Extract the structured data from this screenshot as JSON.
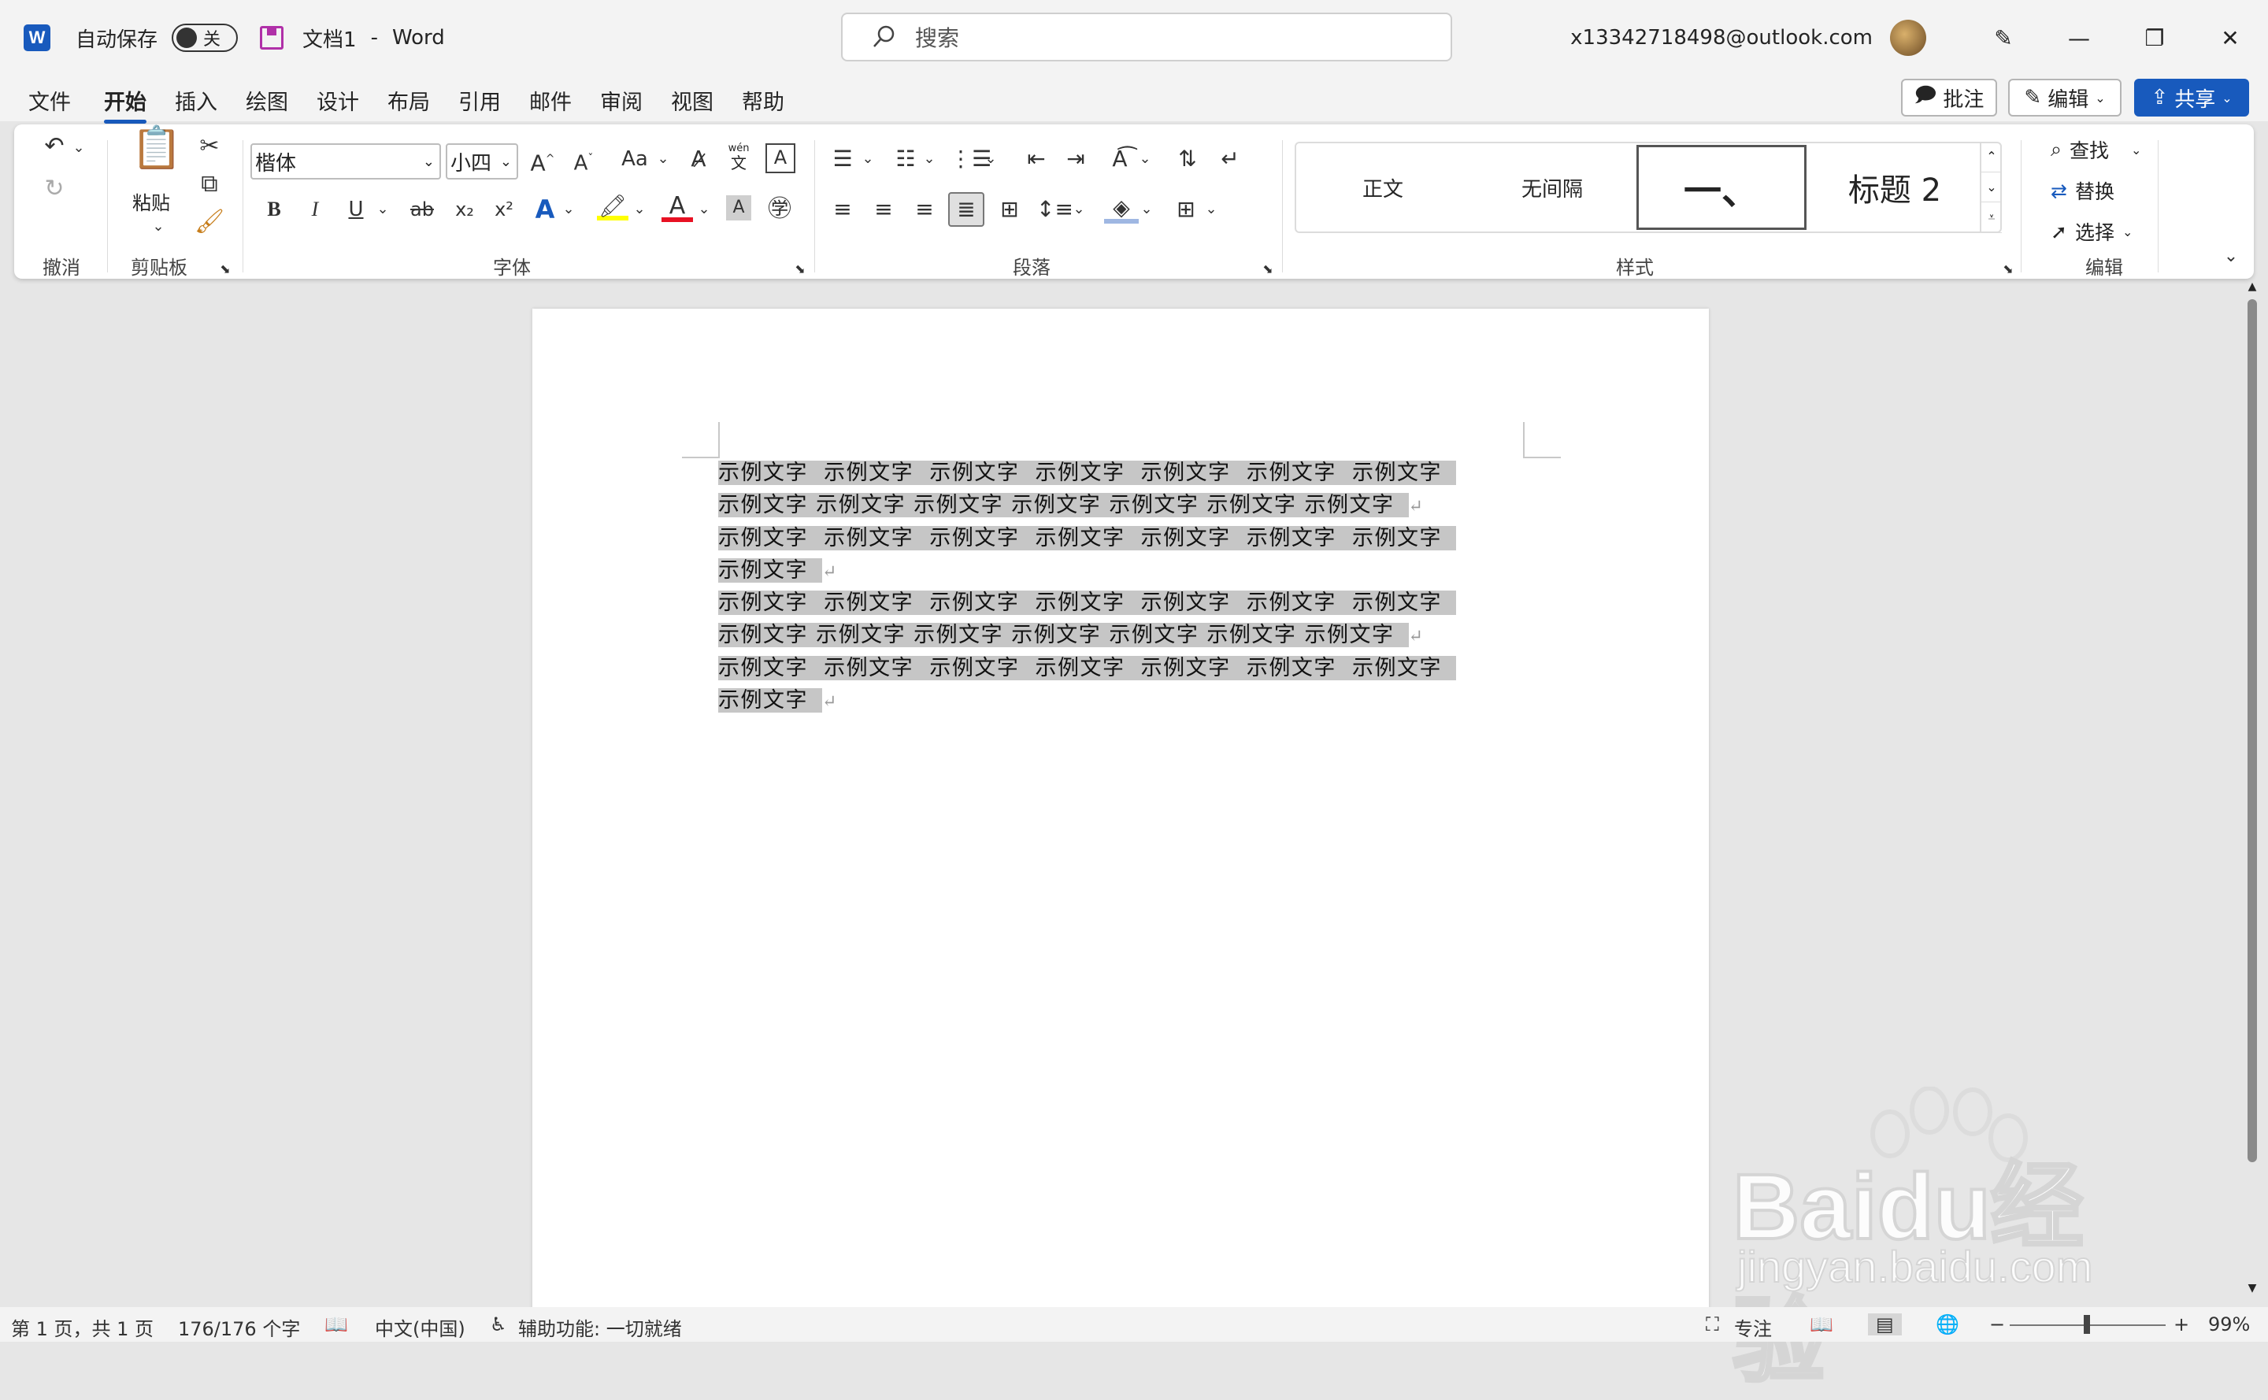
{
  "titlebar": {
    "autosave_label": "自动保存",
    "autosave_state": "关",
    "doc_title": "文档1",
    "separator": "-",
    "app_name": "Word",
    "search_placeholder": "搜索",
    "account": "x13342718498@outlook.com"
  },
  "tabs": [
    "文件",
    "开始",
    "插入",
    "绘图",
    "设计",
    "布局",
    "引用",
    "邮件",
    "审阅",
    "视图",
    "帮助"
  ],
  "active_tab": "开始",
  "topbuttons": {
    "comments": "批注",
    "editing": "编辑",
    "share": "共享"
  },
  "ribbon": {
    "groups": {
      "undo": "撤消",
      "clipboard": "剪贴板",
      "font": "字体",
      "paragraph": "段落",
      "styles": "样式",
      "editing": "编辑"
    },
    "paste_label": "粘贴",
    "font_name": "楷体",
    "font_size": "小四",
    "change_case": "Aa",
    "phonetic_top": "wén",
    "phonetic_bottom": "文",
    "bold": "B",
    "italic": "I",
    "underline": "U",
    "strike": "ab",
    "subscript": "x₂",
    "superscript": "x²",
    "styles": [
      "正文",
      "无间隔",
      "一、",
      "标题 2"
    ],
    "find": "查找",
    "replace": "替换",
    "select": "选择"
  },
  "document": {
    "lines": [
      {
        "text": "示例文字  示例文字  示例文字  示例文字  示例文字  示例文字  示例文字",
        "mark": ""
      },
      {
        "text": "示例文字 示例文字 示例文字 示例文字 示例文字 示例文字 示例文字",
        "mark": "↵"
      },
      {
        "text": "示例文字  示例文字  示例文字  示例文字  示例文字  示例文字  示例文字",
        "mark": ""
      },
      {
        "text": "示例文字",
        "mark": "↵"
      },
      {
        "text": "示例文字  示例文字  示例文字  示例文字  示例文字  示例文字  示例文字",
        "mark": ""
      },
      {
        "text": "示例文字 示例文字 示例文字 示例文字 示例文字 示例文字 示例文字",
        "mark": "↵"
      },
      {
        "text": "示例文字  示例文字  示例文字  示例文字  示例文字  示例文字  示例文字",
        "mark": ""
      },
      {
        "text": "示例文字",
        "mark": "↵"
      }
    ]
  },
  "statusbar": {
    "page": "第 1 页，共 1 页",
    "words": "176/176 个字",
    "language": "中文(中国)",
    "accessibility": "辅助功能: 一切就绪",
    "focus": "专注",
    "zoom": "99%"
  },
  "watermark": {
    "brand": "Baidu经验",
    "url": "jingyan.baidu.com"
  },
  "colors": {
    "accent": "#185abd",
    "highlight": "#c6c6c6",
    "font_color_bar": "#e81123",
    "highlight_bar": "#ffff00"
  }
}
